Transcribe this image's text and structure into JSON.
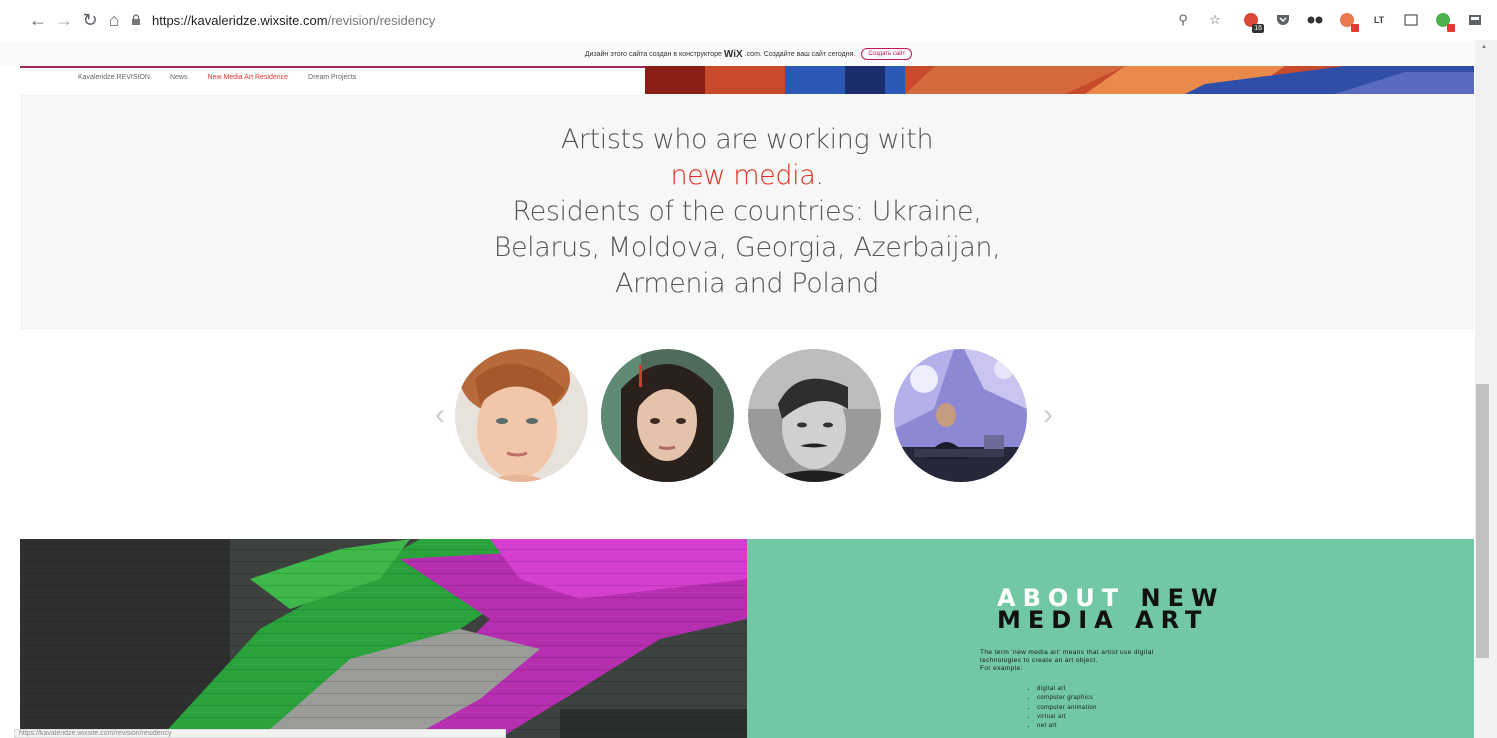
{
  "browser": {
    "url_host": "https://kavaleridze.wixsite.com",
    "url_path": "/revision/residency",
    "extension_badge": "16"
  },
  "wix_banner": {
    "text_before": "Дизайн этого сайта создан в конструкторе",
    "brand": "WiX",
    "text_after": ".com. Создайте ваш сайт сегодня.",
    "button_label": "Создать сайт"
  },
  "site_nav": {
    "items": [
      {
        "label": "Kavaleridze.REVISION"
      },
      {
        "label": "News"
      },
      {
        "label": "New Media Art Residence"
      },
      {
        "label": "Dream Projects"
      }
    ]
  },
  "heading": {
    "line1": "Artists who are working with",
    "highlight": "new media",
    "period": ".",
    "line3": "Residents of the countries: Ukraine,",
    "line4": "Belarus, Moldova, Georgia, Azerbaijan,",
    "line5": "Armenia and Poland"
  },
  "slider": {
    "prev_label": "‹",
    "next_label": "›"
  },
  "about": {
    "title_word1": "ABOUT",
    "title_word2": "NEW",
    "title_line2": "MEDIA ART",
    "description": "The term 'new media art' means that artist use digital technologies to create an art object.",
    "for_example": "For example:",
    "list": [
      "digital art",
      "computer graphics",
      "computer animation",
      "virtual art",
      "net art"
    ]
  },
  "status_bar": {
    "url": "https://kavaleridze.wixsite.com/revision/residency"
  },
  "colors": {
    "accent_red": "#e0301e",
    "about_bg": "#72c8a5",
    "nav_line": "#a02660"
  }
}
